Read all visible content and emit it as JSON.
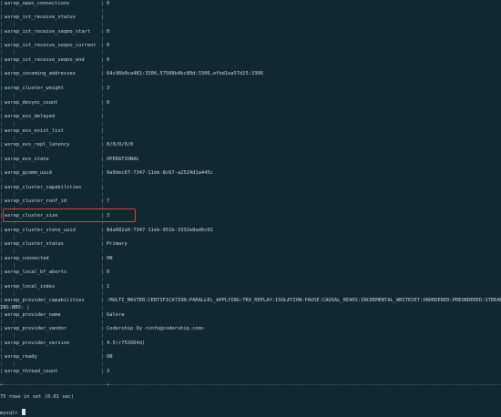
{
  "rows": [
    {
      "key": "wsrep_open_connections",
      "value": "0"
    },
    {
      "key": "wsrep_ist_receive_status",
      "value": ""
    },
    {
      "key": "wsrep_ist_receive_seqno_start",
      "value": "0"
    },
    {
      "key": "wsrep_ist_receive_seqno_current",
      "value": "0"
    },
    {
      "key": "wsrep_ist_receive_seqno_end",
      "value": "0"
    },
    {
      "key": "wsrep_incoming_addresses",
      "value": "64c96b0ca481:3306,57508b4bc80d:3306,efbd1ea57d25:3306"
    },
    {
      "key": "wsrep_cluster_weight",
      "value": "3"
    },
    {
      "key": "wsrep_desync_count",
      "value": "0"
    },
    {
      "key": "wsrep_evs_delayed",
      "value": ""
    },
    {
      "key": "wsrep_evs_evict_list",
      "value": ""
    },
    {
      "key": "wsrep_evs_repl_latency",
      "value": "0/0/0/0/0"
    },
    {
      "key": "wsrep_evs_state",
      "value": "OPERATIONAL"
    },
    {
      "key": "wsrep_gcomm_uuid",
      "value": "9a0dec67-7347-11eb-8c67-a2524d1a445c"
    },
    {
      "key": "wsrep_cluster_capabilities",
      "value": ""
    },
    {
      "key": "wsrep_cluster_conf_id",
      "value": "7"
    },
    {
      "key": "wsrep_cluster_size",
      "value": "3"
    },
    {
      "key": "wsrep_cluster_state_uuid",
      "value": "8da082a9-7347-11eb-951b-3332e8ad6c02"
    },
    {
      "key": "wsrep_cluster_status",
      "value": "Primary"
    },
    {
      "key": "wsrep_connected",
      "value": "ON"
    },
    {
      "key": "wsrep_local_bf_aborts",
      "value": "0"
    },
    {
      "key": "wsrep_local_index",
      "value": "1"
    },
    {
      "key": "wsrep_provider_capabilities",
      "value": ":MULTI_MASTER:CERTIFICATION:PARALLEL_APPLYING:TRX_REPLAY:ISOLATION:PAUSE:CAUSAL_READS:INCREMENTAL_WRITESET:UNORDERED:PREORDERED:STREAM"
    },
    {
      "key": "wsrep_provider_name",
      "value": "Galera"
    },
    {
      "key": "wsrep_provider_vendor",
      "value": "Codership Oy <info@codership.com>"
    },
    {
      "key": "wsrep_provider_version",
      "value": "4.5(r752664d)"
    },
    {
      "key": "wsrep_ready",
      "value": "ON"
    },
    {
      "key": "wsrep_thread_count",
      "value": "3"
    }
  ],
  "wrap_continuation": "ING:NBO: |",
  "table_border": "+-----------------------------------+----------------------------------------------------------------------------------------------------------------------------------------------------------------",
  "status": "75 rows in set (0.01 sec)",
  "prompt": "mysql>",
  "highlight_color": "#e0402b",
  "background_color": "#112831"
}
